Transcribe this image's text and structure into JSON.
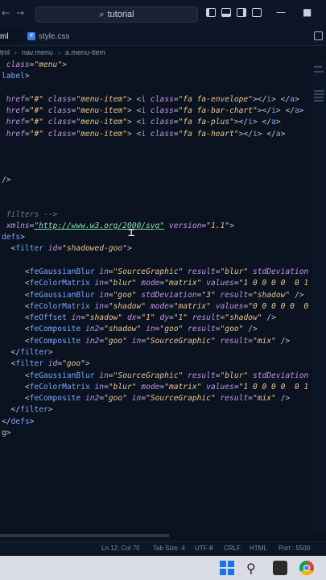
{
  "titlebar": {
    "search_text": "tutorial"
  },
  "tabs": {
    "active_partial": "ml",
    "css_tab": "style.css"
  },
  "breadcrumb": {
    "items": [
      "tml",
      "nav.menu",
      "a.menu-item"
    ]
  },
  "code_lines": [
    [
      [
        "attr",
        " class"
      ],
      [
        "br",
        "="
      ],
      [
        "str",
        "\"menu\""
      ],
      [
        "br",
        ">"
      ]
    ],
    [
      [
        "tag",
        "label"
      ],
      [
        "br",
        ">"
      ]
    ],
    [],
    [
      [
        "attr",
        " href"
      ],
      [
        "br",
        "="
      ],
      [
        "str",
        "\"#\""
      ],
      [
        "attr",
        " class"
      ],
      [
        "br",
        "="
      ],
      [
        "str",
        "\"menu-item\""
      ],
      [
        "br",
        "> <"
      ],
      [
        "tag",
        "i"
      ],
      [
        "attr",
        " class"
      ],
      [
        "br",
        "="
      ],
      [
        "str",
        "\"fa fa-envelope\""
      ],
      [
        "br",
        "></"
      ],
      [
        "tag",
        "i"
      ],
      [
        "br",
        "> </"
      ],
      [
        "tag",
        "a"
      ],
      [
        "br",
        ">"
      ]
    ],
    [
      [
        "attr",
        " href"
      ],
      [
        "br",
        "="
      ],
      [
        "str",
        "\"#\""
      ],
      [
        "attr",
        " class"
      ],
      [
        "br",
        "="
      ],
      [
        "str",
        "\"menu-item\""
      ],
      [
        "br",
        "> <"
      ],
      [
        "tag",
        "i"
      ],
      [
        "attr",
        " class"
      ],
      [
        "br",
        "="
      ],
      [
        "str",
        "\"fa fa-bar-chart\""
      ],
      [
        "br",
        "></"
      ],
      [
        "tag",
        "i"
      ],
      [
        "br",
        "> </"
      ],
      [
        "tag",
        "a"
      ],
      [
        "br",
        ">"
      ]
    ],
    [
      [
        "attr",
        " href"
      ],
      [
        "br",
        "="
      ],
      [
        "str",
        "\"#\""
      ],
      [
        "attr",
        " class"
      ],
      [
        "br",
        "="
      ],
      [
        "str",
        "\"menu-item\""
      ],
      [
        "br",
        "> <"
      ],
      [
        "tag",
        "i"
      ],
      [
        "attr",
        " class"
      ],
      [
        "br",
        "="
      ],
      [
        "str",
        "\"fa fa-plus\""
      ],
      [
        "br",
        "></"
      ],
      [
        "tag",
        "i"
      ],
      [
        "br",
        "> </"
      ],
      [
        "tag",
        "a"
      ],
      [
        "br",
        ">"
      ]
    ],
    [
      [
        "attr",
        " href"
      ],
      [
        "br",
        "="
      ],
      [
        "str",
        "\"#\""
      ],
      [
        "attr",
        " class"
      ],
      [
        "br",
        "="
      ],
      [
        "str",
        "\"menu-item\""
      ],
      [
        "br",
        "> <"
      ],
      [
        "tag",
        "i"
      ],
      [
        "attr",
        " class"
      ],
      [
        "br",
        "="
      ],
      [
        "str",
        "\"fa fa-heart\""
      ],
      [
        "br",
        "></"
      ],
      [
        "tag",
        "i"
      ],
      [
        "br",
        "> </"
      ],
      [
        "tag",
        "a"
      ],
      [
        "br",
        ">"
      ]
    ],
    [],
    [],
    [],
    [
      [
        "br",
        "/>"
      ]
    ],
    [],
    [],
    [
      [
        "cmt",
        " filters -->"
      ]
    ],
    [
      [
        "attr",
        " xmlns"
      ],
      [
        "br",
        "="
      ],
      [
        "url",
        "\"http://www.w3.org/2000/svg\""
      ],
      [
        "attr",
        " version"
      ],
      [
        "br",
        "="
      ],
      [
        "str",
        "\"1.1\""
      ],
      [
        "br",
        ">"
      ]
    ],
    [
      [
        "tag",
        "defs"
      ],
      [
        "br",
        ">"
      ]
    ],
    [
      [
        "br",
        "  <"
      ],
      [
        "tag",
        "filter"
      ],
      [
        "attr",
        " id"
      ],
      [
        "br",
        "="
      ],
      [
        "str",
        "\"shadowed-goo\""
      ],
      [
        "br",
        ">"
      ]
    ],
    [],
    [
      [
        "br",
        "     <"
      ],
      [
        "tag",
        "feGaussianBlur"
      ],
      [
        "attr",
        " in"
      ],
      [
        "br",
        "="
      ],
      [
        "str",
        "\"SourceGraphic\""
      ],
      [
        "attr",
        " result"
      ],
      [
        "br",
        "="
      ],
      [
        "str",
        "\"blur\""
      ],
      [
        "attr",
        " stdDeviation"
      ]
    ],
    [
      [
        "br",
        "     <"
      ],
      [
        "tag",
        "feColorMatrix"
      ],
      [
        "attr",
        " in"
      ],
      [
        "br",
        "="
      ],
      [
        "str",
        "\"blur\""
      ],
      [
        "attr",
        " mode"
      ],
      [
        "br",
        "="
      ],
      [
        "str",
        "\"matrix\""
      ],
      [
        "attr",
        " values"
      ],
      [
        "br",
        "="
      ],
      [
        "str",
        "\"1 0 0 0 0  0 1"
      ]
    ],
    [
      [
        "br",
        "     <"
      ],
      [
        "tag",
        "feGaussianBlur"
      ],
      [
        "attr",
        " in"
      ],
      [
        "br",
        "="
      ],
      [
        "str",
        "\"goo\""
      ],
      [
        "attr",
        " stdDeviation"
      ],
      [
        "br",
        "="
      ],
      [
        "str",
        "\"3\""
      ],
      [
        "attr",
        " result"
      ],
      [
        "br",
        "="
      ],
      [
        "str",
        "\"shadow\""
      ],
      [
        "br",
        " />"
      ]
    ],
    [
      [
        "br",
        "     <"
      ],
      [
        "tag",
        "feColorMatrix"
      ],
      [
        "attr",
        " in"
      ],
      [
        "br",
        "="
      ],
      [
        "str",
        "\"shadow\""
      ],
      [
        "attr",
        " mode"
      ],
      [
        "br",
        "="
      ],
      [
        "str",
        "\"matrix\""
      ],
      [
        "attr",
        " values"
      ],
      [
        "br",
        "="
      ],
      [
        "str",
        "\"0 0 0 0 0  0"
      ]
    ],
    [
      [
        "br",
        "     <"
      ],
      [
        "tag",
        "feOffset"
      ],
      [
        "attr",
        " in"
      ],
      [
        "br",
        "="
      ],
      [
        "str",
        "\"shadow\""
      ],
      [
        "attr",
        " dx"
      ],
      [
        "br",
        "="
      ],
      [
        "str",
        "\"1\""
      ],
      [
        "attr",
        " dy"
      ],
      [
        "br",
        "="
      ],
      [
        "str",
        "\"1\""
      ],
      [
        "attr",
        " result"
      ],
      [
        "br",
        "="
      ],
      [
        "str",
        "\"shadow\""
      ],
      [
        "br",
        " />"
      ]
    ],
    [
      [
        "br",
        "     <"
      ],
      [
        "tag",
        "feComposite"
      ],
      [
        "attr",
        " in2"
      ],
      [
        "br",
        "="
      ],
      [
        "str",
        "\"shadow\""
      ],
      [
        "attr",
        " in"
      ],
      [
        "br",
        "="
      ],
      [
        "str",
        "\"goo\""
      ],
      [
        "attr",
        " result"
      ],
      [
        "br",
        "="
      ],
      [
        "str",
        "\"goo\""
      ],
      [
        "br",
        " />"
      ]
    ],
    [
      [
        "br",
        "     <"
      ],
      [
        "tag",
        "feComposite"
      ],
      [
        "attr",
        " in2"
      ],
      [
        "br",
        "="
      ],
      [
        "str",
        "\"goo\""
      ],
      [
        "attr",
        " in"
      ],
      [
        "br",
        "="
      ],
      [
        "str",
        "\"SourceGraphic\""
      ],
      [
        "attr",
        " result"
      ],
      [
        "br",
        "="
      ],
      [
        "str",
        "\"mix\""
      ],
      [
        "br",
        " />"
      ]
    ],
    [
      [
        "br",
        "  </"
      ],
      [
        "tag",
        "filter"
      ],
      [
        "br",
        ">"
      ]
    ],
    [
      [
        "br",
        "  <"
      ],
      [
        "tag",
        "filter"
      ],
      [
        "attr",
        " id"
      ],
      [
        "br",
        "="
      ],
      [
        "str",
        "\"goo\""
      ],
      [
        "br",
        ">"
      ]
    ],
    [
      [
        "br",
        "     <"
      ],
      [
        "tag",
        "feGaussianBlur"
      ],
      [
        "attr",
        " in"
      ],
      [
        "br",
        "="
      ],
      [
        "str",
        "\"SourceGraphic\""
      ],
      [
        "attr",
        " result"
      ],
      [
        "br",
        "="
      ],
      [
        "str",
        "\"blur\""
      ],
      [
        "attr",
        " stdDeviation"
      ]
    ],
    [
      [
        "br",
        "     <"
      ],
      [
        "tag",
        "feColorMatrix"
      ],
      [
        "attr",
        " in"
      ],
      [
        "br",
        "="
      ],
      [
        "str",
        "\"blur\""
      ],
      [
        "attr",
        " mode"
      ],
      [
        "br",
        "="
      ],
      [
        "str",
        "\"matrix\""
      ],
      [
        "attr",
        " values"
      ],
      [
        "br",
        "="
      ],
      [
        "str",
        "\"1 0 0 0 0  0 1"
      ]
    ],
    [
      [
        "br",
        "     <"
      ],
      [
        "tag",
        "feComposite"
      ],
      [
        "attr",
        " in2"
      ],
      [
        "br",
        "="
      ],
      [
        "str",
        "\"goo\""
      ],
      [
        "attr",
        " in"
      ],
      [
        "br",
        "="
      ],
      [
        "str",
        "\"SourceGraphic\""
      ],
      [
        "attr",
        " result"
      ],
      [
        "br",
        "="
      ],
      [
        "str",
        "\"mix\""
      ],
      [
        "br",
        " />"
      ]
    ],
    [
      [
        "br",
        "  </"
      ],
      [
        "tag",
        "filter"
      ],
      [
        "br",
        ">"
      ]
    ],
    [
      [
        "br",
        "</"
      ],
      [
        "tag",
        "defs"
      ],
      [
        "br",
        ">"
      ]
    ],
    [
      [
        "br",
        "g>"
      ]
    ]
  ],
  "status": {
    "position": "Ln 12, Col 70",
    "tab": "Tab Size: 4",
    "encoding": "UTF-8",
    "eol": "CRLF",
    "lang": "HTML",
    "port": "Port : 5500"
  },
  "colors": {
    "bg": "#0b1220",
    "tag": "#7aa6ff",
    "attr": "#c792ea",
    "string": "#ecc48d"
  }
}
